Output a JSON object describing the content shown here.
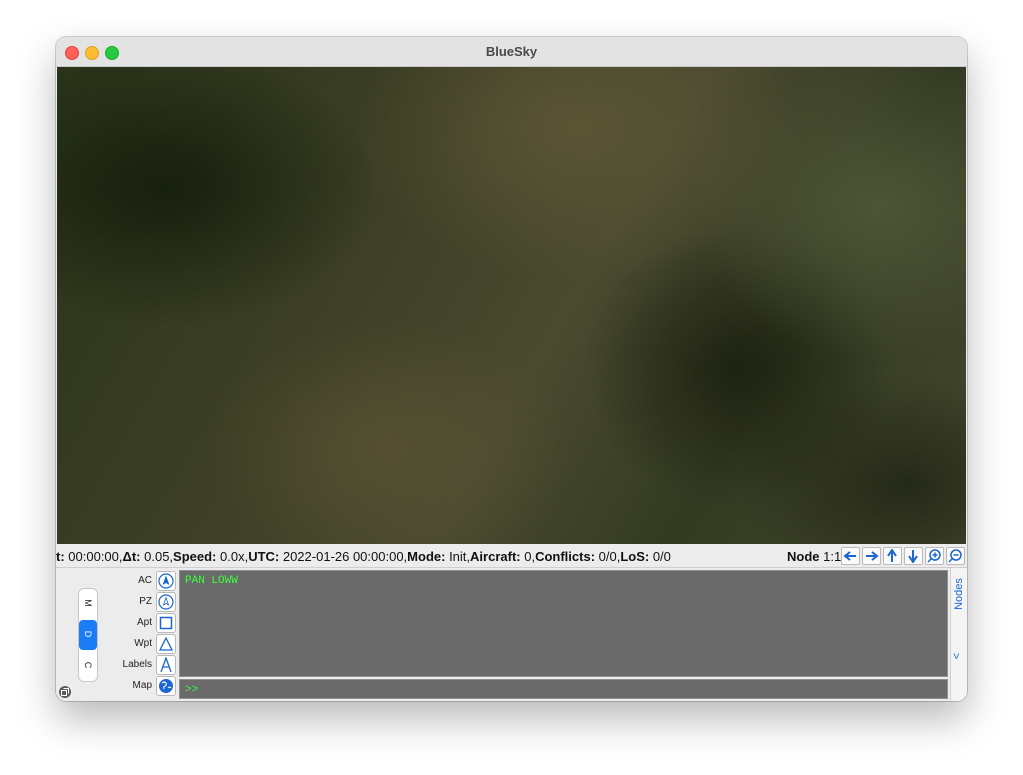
{
  "window": {
    "title": "BlueSky"
  },
  "status": {
    "t_label": "t:",
    "t_value": " 00:00:00,",
    "dt_label": "Δt:",
    "dt_value": " 0.05,",
    "speed_label": "Speed:",
    "speed_value": " 0.0x,",
    "utc_label": "UTC:",
    "utc_value": " 2022-01-26 00:00:00,",
    "mode_label": "Mode:",
    "mode_value": " Init,",
    "aircraft_label": "Aircraft:",
    "aircraft_value": " 0,",
    "conflicts_label": "Conflicts:",
    "conflicts_value": " 0/0,",
    "los_label": "LoS:",
    "los_value": " 0/0",
    "node_label": "Node",
    "node_value": " 1:1"
  },
  "nav_icons": [
    "arrow-left-icon",
    "arrow-right-icon",
    "arrow-up-icon",
    "arrow-down-icon",
    "zoom-in-icon",
    "zoom-out-icon"
  ],
  "side_tabs": [
    {
      "label": "M",
      "active": false
    },
    {
      "label": "D",
      "active": true
    },
    {
      "label": "C",
      "active": false
    }
  ],
  "toggles": [
    {
      "label": "AC",
      "icon": "aircraft-icon"
    },
    {
      "label": "PZ",
      "icon": "protected-zone-icon"
    },
    {
      "label": "Apt",
      "icon": "airport-icon"
    },
    {
      "label": "Wpt",
      "icon": "waypoint-icon"
    },
    {
      "label": "Labels",
      "icon": "labels-icon"
    },
    {
      "label": "Map",
      "icon": "globe-icon"
    }
  ],
  "echo": {
    "text": "PAN LOWW"
  },
  "command": {
    "prompt": ">>",
    "value": ""
  },
  "nodes_panel": {
    "label": "Nodes",
    "chevron": "<"
  },
  "colors": {
    "accent": "#1b66d0",
    "console_text": "#3cff3c",
    "console_bg": "#6a6a6a"
  }
}
